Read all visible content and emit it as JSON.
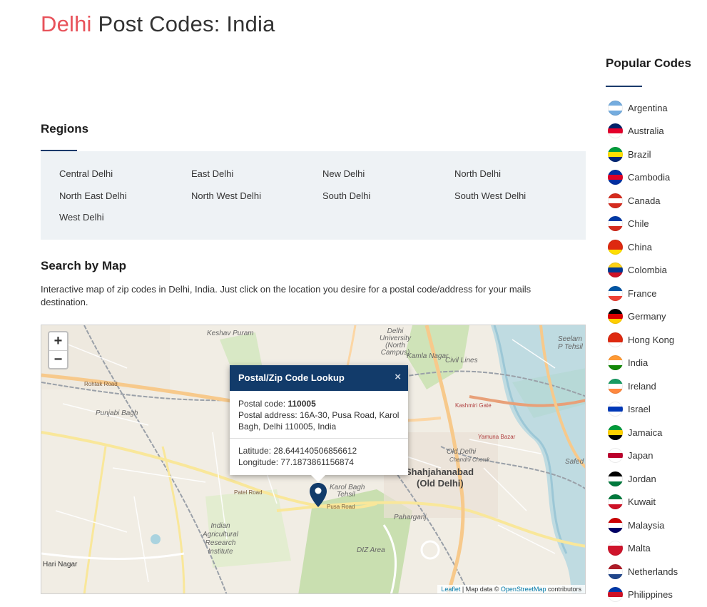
{
  "page": {
    "title_city": "Delhi",
    "title_rest": " Post Codes: India"
  },
  "regions": {
    "heading": "Regions",
    "items": [
      "Central Delhi",
      "East Delhi",
      "New Delhi",
      "North Delhi",
      "North East Delhi",
      "North West Delhi",
      "South Delhi",
      "South West Delhi",
      "West Delhi"
    ]
  },
  "search_map": {
    "heading": "Search by Map",
    "description": "Interactive map of zip codes in Delhi, India. Just click on the location you desire for a postal code/address for your mails destination."
  },
  "map": {
    "zoom_in": "+",
    "zoom_out": "−",
    "popup": {
      "title": "Postal/Zip Code Lookup",
      "close": "×",
      "postal_code_label": "Postal code: ",
      "postal_code": "110005",
      "address_label": "Postal address: ",
      "address": "16A-30, Pusa Road, Karol Bagh, Delhi 110005, India",
      "latitude_label": "Latitude: ",
      "latitude": "28.644140506856612",
      "longitude_label": "Longitude: ",
      "longitude": "77.1873861156874"
    },
    "labels": {
      "keshav_puram": "Keshav Puram",
      "delhi_university": "Delhi University (North Campus)",
      "kamla_nagar": "Kamla Nagar",
      "civil_lines": "Civil Lines",
      "punjabi_bagh": "Punjabi Bagh",
      "shahjahanabad": "Shahjahanabad",
      "old_delhi_paren": "(Old Delhi)",
      "old_delhi": "Old Delhi",
      "chandni_chowk": "Chandni Chowk",
      "karol_bagh": "Karol Bagh",
      "tehsil": "Tehsil",
      "paharganj": "Paharganj",
      "indian_agri": "Indian Agricultural Research Institute",
      "hari_nagar": "Hari Nagar",
      "seelampur": "Seelam P Tehsil",
      "safed": "Safed",
      "rohtak_road": "Rohtak Road",
      "pusa_road": "Pusa Road",
      "patel_road": "Patel Road",
      "yamuna_bazar": "Yamuna Bazar",
      "kashmiri_gate": "Kashmiri Gate",
      "dizarea": "DIZ Area"
    },
    "attribution_leaflet": "Leaflet",
    "attribution_mid": " | Map data © ",
    "attribution_osm": "OpenStreetMap",
    "attribution_end": " contributors"
  },
  "sidebar": {
    "heading": "Popular Codes",
    "countries": [
      {
        "name": "Argentina",
        "flag": "argentina-flag-icon",
        "colors": [
          "#74acdf",
          "#ffffff",
          "#74acdf"
        ]
      },
      {
        "name": "Australia",
        "flag": "australia-flag-icon",
        "colors": [
          "#012169",
          "#e4002b",
          "#ffffff"
        ]
      },
      {
        "name": "Brazil",
        "flag": "brazil-flag-icon",
        "colors": [
          "#009c3b",
          "#ffdf00",
          "#002776"
        ]
      },
      {
        "name": "Cambodia",
        "flag": "cambodia-flag-icon",
        "colors": [
          "#032ea1",
          "#e00025",
          "#032ea1"
        ]
      },
      {
        "name": "Canada",
        "flag": "canada-flag-icon",
        "colors": [
          "#d52b1e",
          "#ffffff",
          "#d52b1e"
        ]
      },
      {
        "name": "Chile",
        "flag": "chile-flag-icon",
        "colors": [
          "#0039a6",
          "#ffffff",
          "#d52b1e"
        ]
      },
      {
        "name": "China",
        "flag": "china-flag-icon",
        "colors": [
          "#de2910",
          "#de2910",
          "#ffde00"
        ]
      },
      {
        "name": "Colombia",
        "flag": "colombia-flag-icon",
        "colors": [
          "#fcd116",
          "#003893",
          "#ce1126"
        ]
      },
      {
        "name": "France",
        "flag": "france-flag-icon",
        "colors": [
          "#0055a4",
          "#ffffff",
          "#ef4135"
        ]
      },
      {
        "name": "Germany",
        "flag": "germany-flag-icon",
        "colors": [
          "#000000",
          "#dd0000",
          "#ffce00"
        ]
      },
      {
        "name": "Hong Kong",
        "flag": "hong-kong-flag-icon",
        "colors": [
          "#de2910",
          "#de2910",
          "#ffffff"
        ]
      },
      {
        "name": "India",
        "flag": "india-flag-icon",
        "colors": [
          "#ff9933",
          "#ffffff",
          "#138808"
        ]
      },
      {
        "name": "Ireland",
        "flag": "ireland-flag-icon",
        "colors": [
          "#169b62",
          "#ffffff",
          "#ff883e"
        ]
      },
      {
        "name": "Israel",
        "flag": "israel-flag-icon",
        "colors": [
          "#ffffff",
          "#0038b8",
          "#ffffff"
        ]
      },
      {
        "name": "Jamaica",
        "flag": "jamaica-flag-icon",
        "colors": [
          "#009b3a",
          "#fed100",
          "#000000"
        ]
      },
      {
        "name": "Japan",
        "flag": "japan-flag-icon",
        "colors": [
          "#ffffff",
          "#bc002d",
          "#ffffff"
        ]
      },
      {
        "name": "Jordan",
        "flag": "jordan-flag-icon",
        "colors": [
          "#000000",
          "#ffffff",
          "#007a3d"
        ]
      },
      {
        "name": "Kuwait",
        "flag": "kuwait-flag-icon",
        "colors": [
          "#007a3d",
          "#ffffff",
          "#ce1126"
        ]
      },
      {
        "name": "Malaysia",
        "flag": "malaysia-flag-icon",
        "colors": [
          "#cc0001",
          "#ffffff",
          "#010066"
        ]
      },
      {
        "name": "Malta",
        "flag": "malta-flag-icon",
        "colors": [
          "#ffffff",
          "#cf142b",
          "#cf142b"
        ]
      },
      {
        "name": "Netherlands",
        "flag": "netherlands-flag-icon",
        "colors": [
          "#ae1c28",
          "#ffffff",
          "#21468b"
        ]
      },
      {
        "name": "Philippines",
        "flag": "philippines-flag-icon",
        "colors": [
          "#0038a8",
          "#ce1126",
          "#ffffff"
        ]
      }
    ]
  }
}
